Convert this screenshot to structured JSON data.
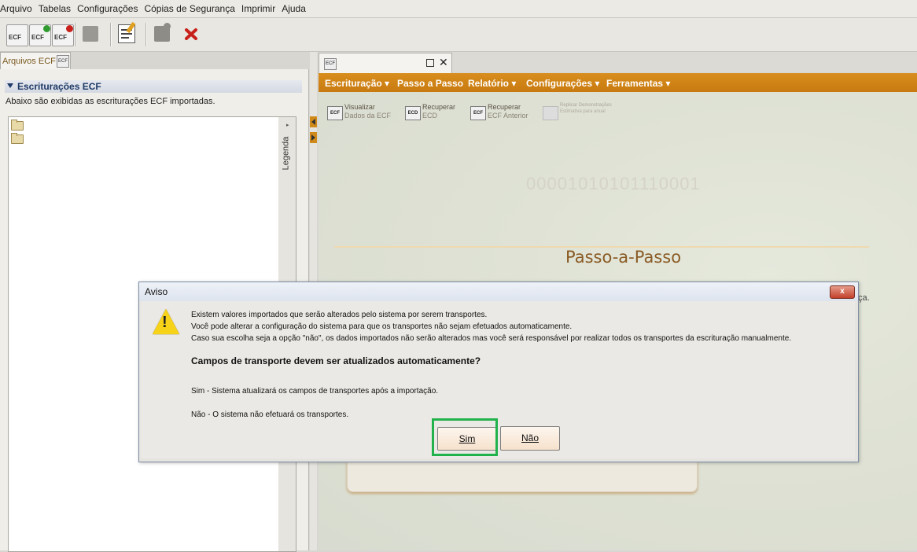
{
  "menubar": {
    "items": [
      "Arquivo",
      "Tabelas",
      "Configurações",
      "Cópias de Segurança",
      "Imprimir",
      "Ajuda"
    ]
  },
  "toolbar": {
    "buttons": [
      {
        "label": "ECF",
        "icon": "ecf-icon"
      },
      {
        "label": "ECF",
        "icon": "ecf-new-icon"
      },
      {
        "label": "ECF",
        "icon": "ecf-delete-icon"
      },
      {
        "label": "",
        "icon": "package-icon"
      },
      {
        "label": "",
        "icon": "edit-document-icon"
      },
      {
        "label": "",
        "icon": "database-icon"
      },
      {
        "label": "",
        "icon": "close-x-icon"
      }
    ]
  },
  "left_panel": {
    "tab_label": "Arquivos ECF",
    "tab_icon_label": "ECF",
    "section_title": "Escriturações ECF",
    "section_desc": "Abaixo são exibidas as escriturações ECF importadas.",
    "legend_label": "Legenda"
  },
  "right_panel": {
    "tab_icon_label": "ECF",
    "menu": [
      "Escrituração",
      "Passo a Passo",
      "Relatório",
      "Configurações",
      "Ferramentas"
    ],
    "actions": [
      {
        "icon": "ECF",
        "line1": "Visualizar",
        "line2": "Dados da ECF"
      },
      {
        "icon": "ECD",
        "line1": "Recuperar",
        "line2": "ECD"
      },
      {
        "icon": "ECF",
        "line1": "Recuperar",
        "line2": "ECF Anterior"
      },
      {
        "icon": "",
        "line1": "Replicar Demonstrações",
        "line2": "Estimativa para anual"
      }
    ],
    "binary_text": "00001010101110001",
    "section_title": "Passo-a-Passo",
    "truncated_text": "ça."
  },
  "dialog": {
    "title": "Aviso",
    "close_symbol": "x",
    "warn_symbol": "!",
    "lines": [
      "Existem valores importados que serão alterados pelo sistema por serem transportes.",
      "Você pode alterar a configuração do sistema para que os transportes não sejam efetuados automaticamente.",
      "Caso sua escolha seja a opção \"não\", os dados importados não serão alterados mas você será responsável por realizar todos os transportes da escrituração manualmente."
    ],
    "question": "Campos de transporte devem ser atualizados automaticamente?",
    "option_sim": "Sim - Sistema atualizará os campos de transportes após a importação.",
    "option_nao": "Não - O sistema não efetuará os transportes.",
    "button_sim": "Sim",
    "button_nao": "Não"
  },
  "colors": {
    "accent_orange": "#c87a10",
    "highlight_green": "#22b24c",
    "warning_yellow": "#f6d318"
  }
}
